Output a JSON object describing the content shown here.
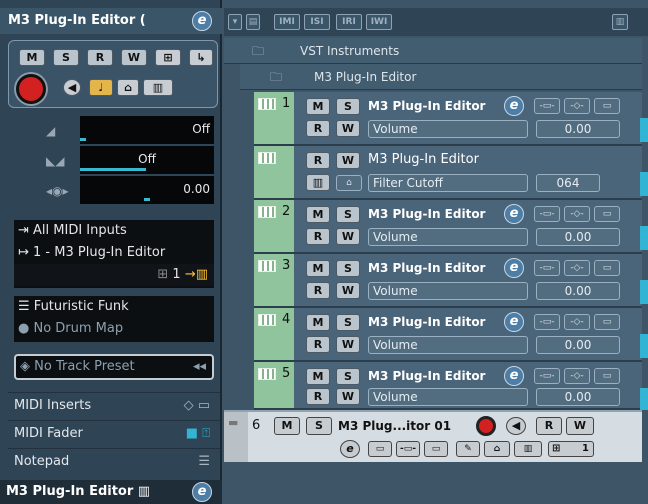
{
  "inspector": {
    "title": "M3 Plug-In Editor (",
    "e_label": "e",
    "buttons": {
      "mute": "M",
      "solo": "S",
      "read": "R",
      "write": "W"
    },
    "volume_value": "Off",
    "pan_value": "Off",
    "delay_value": "0.00",
    "midi_input": "All MIDI Inputs",
    "midi_output": "1 - M3 Plug-In Editor",
    "channel": "1",
    "program": "Futuristic Funk",
    "drum_map": "No Drum Map",
    "track_preset": "No Track Preset",
    "sections": [
      "MIDI Inserts",
      "MIDI Fader",
      "Notepad"
    ],
    "footer_title": "M3 Plug-In Editor"
  },
  "folders": [
    {
      "label": "VST Instruments"
    },
    {
      "label": "M3 Plug-In Editor"
    }
  ],
  "tracks": [
    {
      "num": "1",
      "name": "M3 Plug-In Editor",
      "param": "Volume",
      "value": "0.00"
    },
    {
      "num": "",
      "name": "M3 Plug-In Editor",
      "param": "Filter Cutoff",
      "value": "064"
    },
    {
      "num": "2",
      "name": "M3 Plug-In Editor",
      "param": "Volume",
      "value": "0.00"
    },
    {
      "num": "3",
      "name": "M3 Plug-In Editor",
      "param": "Volume",
      "value": "0.00"
    },
    {
      "num": "4",
      "name": "M3 Plug-In Editor",
      "param": "Volume",
      "value": "0.00"
    },
    {
      "num": "5",
      "name": "M3 Plug-In Editor",
      "param": "Volume",
      "value": "0.00"
    }
  ],
  "track6": {
    "num": "6",
    "name": "M3 Plug...itor 01",
    "channel": "1"
  },
  "toolbar": {
    "buttons": [
      "IMI",
      "ISI",
      "IRI",
      "IWI"
    ]
  },
  "colors": {
    "accent": "#32b5d4",
    "record": "#d32020",
    "track_band": "#8fc49c"
  }
}
